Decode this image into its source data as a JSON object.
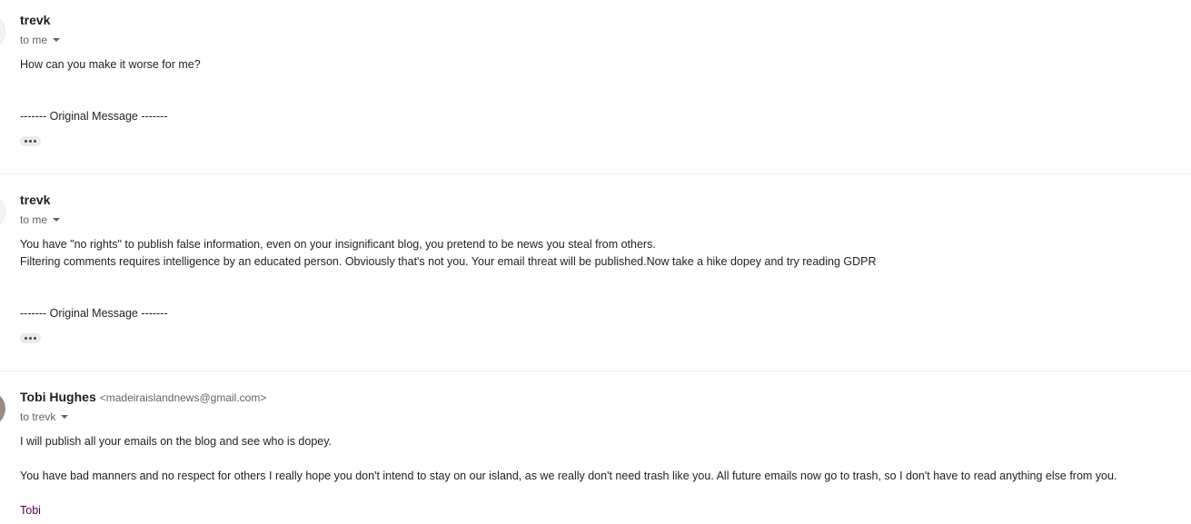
{
  "messages": [
    {
      "sender_name": "trevk",
      "sender_email": "",
      "recipient": "to me",
      "body": "How can you make it worse for me?",
      "original_message": "------- Original Message -------"
    },
    {
      "sender_name": "trevk",
      "sender_email": "",
      "recipient": "to me",
      "body_lines": [
        "You have \"no rights\" to publish false information, even on your insignificant blog, you pretend to be news you steal from others.",
        "Filtering comments requires intelligence by an educated person. Obviously that's not you. Your email threat will be published.Now take a hike dopey and try reading GDPR"
      ],
      "original_message": "------- Original Message -------"
    },
    {
      "sender_name": "Tobi Hughes",
      "sender_email": "<madeiraislandnews@gmail.com>",
      "recipient": "to trevk",
      "body_lines": [
        "I will publish all your emails on the blog and see who is dopey.",
        "You have bad manners and no respect for others I really hope you don't intend to stay on our island, as we really don't need trash like you. All future emails now go to trash, so I don't have to read anything else from you."
      ],
      "signature": "Tobi"
    }
  ],
  "icons": {
    "more": "more-horiz-icon",
    "caret": "caret-down-icon"
  }
}
